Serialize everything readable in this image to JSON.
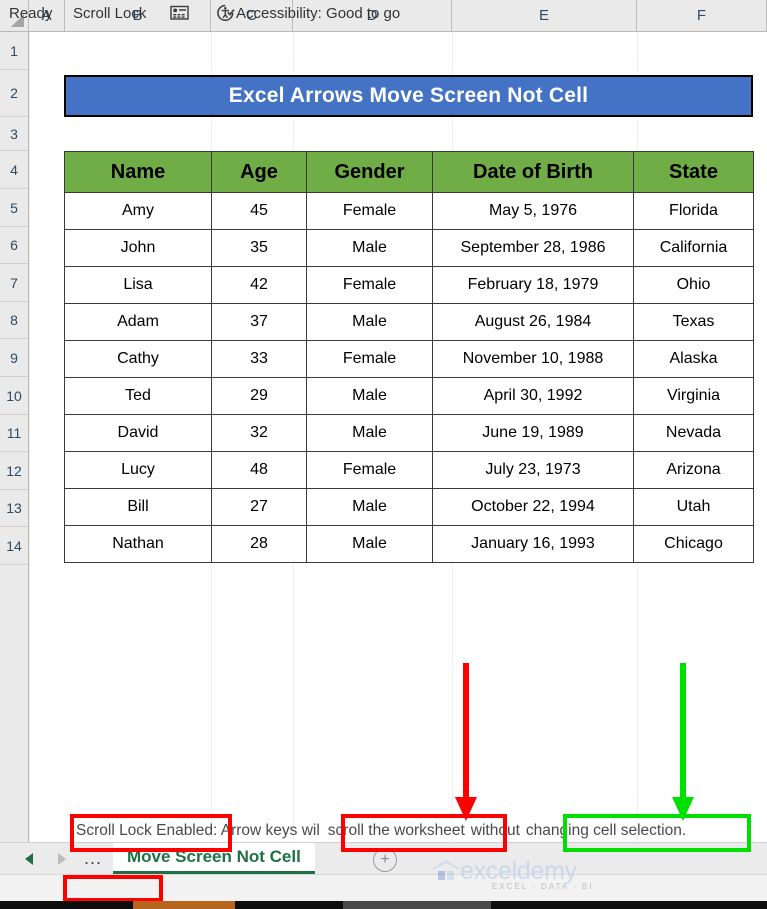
{
  "app": {
    "columns": [
      "A",
      "B",
      "C",
      "D",
      "E",
      "F"
    ],
    "rows": [
      "1",
      "2",
      "3",
      "4",
      "5",
      "6",
      "7",
      "8",
      "9",
      "10",
      "11",
      "12",
      "13",
      "14"
    ]
  },
  "banner": {
    "title": "Excel Arrows Move Screen Not Cell",
    "fill_color": "#4472C4",
    "text_color": "#FFFFFF"
  },
  "table": {
    "header_color": "#70AD47",
    "headers": [
      "Name",
      "Age",
      "Gender",
      "Date of Birth",
      "State"
    ],
    "rows": [
      [
        "Amy",
        "45",
        "Female",
        "May 5, 1976",
        "Florida"
      ],
      [
        "John",
        "35",
        "Male",
        "September 28, 1986",
        "California"
      ],
      [
        "Lisa",
        "42",
        "Female",
        "February 18, 1979",
        "Ohio"
      ],
      [
        "Adam",
        "37",
        "Male",
        "August 26, 1984",
        "Texas"
      ],
      [
        "Cathy",
        "33",
        "Female",
        "November 10, 1988",
        "Alaska"
      ],
      [
        "Ted",
        "29",
        "Male",
        "April 30, 1992",
        "Virginia"
      ],
      [
        "David",
        "32",
        "Male",
        "June 19, 1989",
        "Nevada"
      ],
      [
        "Lucy",
        "48",
        "Female",
        "July 23, 1973",
        "Arizona"
      ],
      [
        "Bill",
        "27",
        "Male",
        "October 22, 1994",
        "Utah"
      ],
      [
        "Nathan",
        "28",
        "Male",
        "January 16, 1993",
        "Chicago"
      ]
    ]
  },
  "annotations": {
    "red_color": "#FF0000",
    "green_color": "#00E000",
    "callout_1_text": "Scroll Lock Enabled:",
    "callout_2_text": "scroll the worksheet",
    "callout_3_text": "changing cell selection.",
    "tooltip_full_text": "Scroll Lock Enabled: Arrow keys will scroll the worksheet without changing cell selection.",
    "tooltip_part_a": "Scroll Lock Enabled: Arrow keys wil",
    "tooltip_part_b": "scroll the worksheet",
    "tooltip_part_c": "without",
    "tooltip_part_d": "changing cell selection."
  },
  "tabbar": {
    "prev_icon": "triangle-left-icon",
    "next_icon": "triangle-right-icon",
    "ellipsis": "...",
    "sheet_name": "Move Screen Not Cell",
    "add_sheet_label": "+"
  },
  "statusbar": {
    "mode": "Ready",
    "scroll_lock": "Scroll Lock",
    "macro_icon": "record-macro-icon",
    "accessibility_icon": "accessibility-icon",
    "accessibility": "Accessibility: Good to go"
  },
  "watermark": {
    "text": "exceldemy",
    "subtext": "EXCEL - DATA - BI"
  }
}
